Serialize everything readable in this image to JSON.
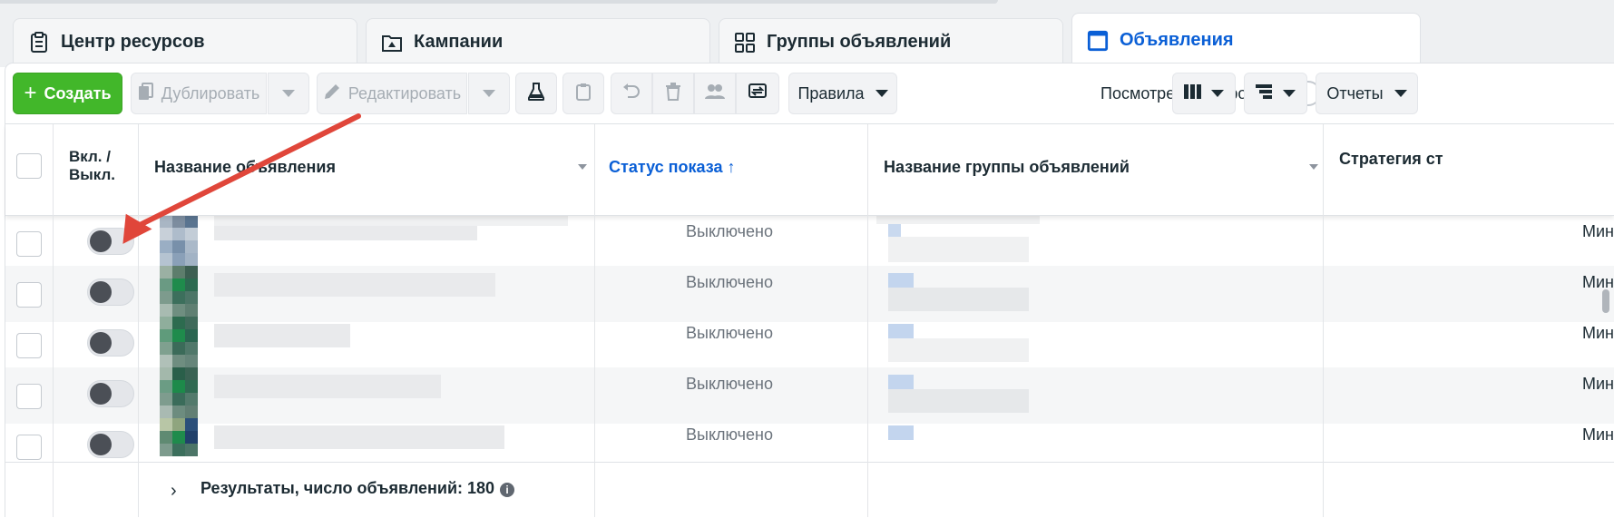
{
  "tabs": [
    {
      "label": "Центр ресурсов",
      "icon": "clipboard-icon"
    },
    {
      "label": "Кампании",
      "icon": "folder-flag-icon"
    },
    {
      "label": "Группы объявлений",
      "icon": "grid-icon"
    },
    {
      "label": "Объявления",
      "icon": "ad-window-icon",
      "active": true
    }
  ],
  "toolbar": {
    "create_label": "Создать",
    "duplicate_label": "Дублировать",
    "edit_label": "Редактировать",
    "rules_label": "Правила",
    "view_settings_label": "Посмотреть настройки",
    "reports_label": "Отчеты"
  },
  "table": {
    "headers": {
      "toggle": "Вкл. / Выкл.",
      "ad_name": "Название объявления",
      "delivery_status": "Статус показа ↑",
      "adset_name": "Название группы объявлений",
      "strategy": "Стратегия ст"
    },
    "rows": [
      {
        "status": "Выключено",
        "strategy": "Мин"
      },
      {
        "status": "Выключено",
        "strategy": "Мин"
      },
      {
        "status": "Выключено",
        "strategy": "Мин"
      },
      {
        "status": "Выключено",
        "strategy": "Мин"
      },
      {
        "status": "Выключено",
        "strategy": "Мин"
      }
    ],
    "footer": "Результаты, число объявлений: 180"
  },
  "colors": {
    "accent_blue": "#0a5fd6",
    "create_green": "#42b72a",
    "annotation_arrow": "#e0463a"
  }
}
